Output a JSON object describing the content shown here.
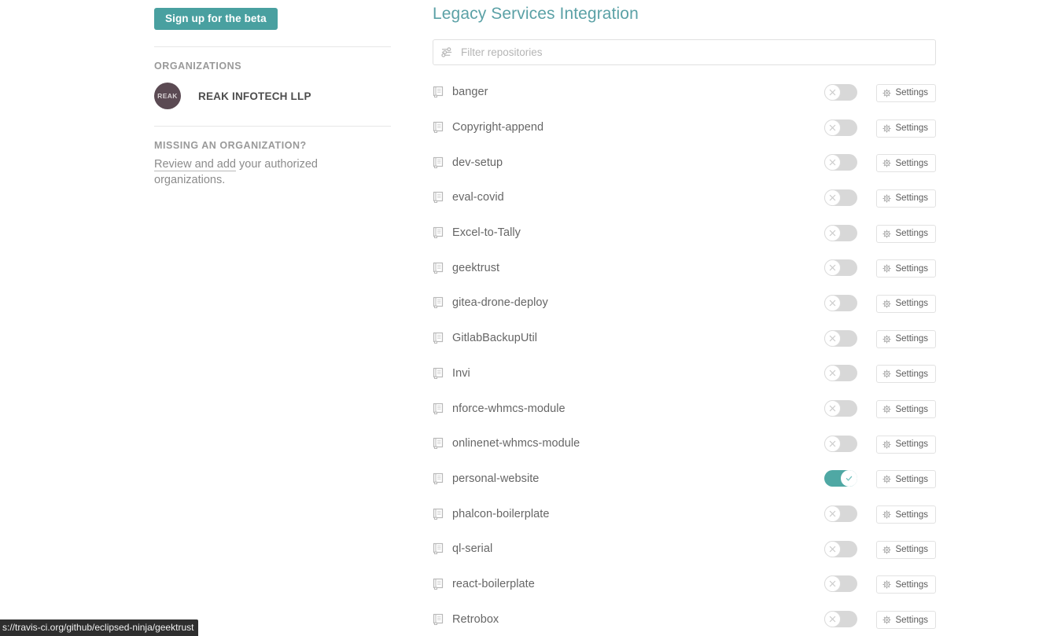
{
  "sidebar": {
    "beta_button_label": "Sign up for the beta",
    "organizations_label": "ORGANIZATIONS",
    "organization": {
      "avatar_text": "REAK",
      "name": "REAK INFOTECH LLP"
    },
    "missing_org_label": "MISSING AN ORGANIZATION?",
    "missing_org_link": "Review and add",
    "missing_org_rest": " your authorized organizations."
  },
  "main": {
    "title": "Legacy Services Integration",
    "filter": {
      "placeholder": "Filter repositories",
      "value": "",
      "icon": "sliders-icon"
    },
    "settings_label": "Settings",
    "repositories": [
      {
        "name": "banger",
        "enabled": false
      },
      {
        "name": "Copyright-append",
        "enabled": false
      },
      {
        "name": "dev-setup",
        "enabled": false
      },
      {
        "name": "eval-covid",
        "enabled": false
      },
      {
        "name": "Excel-to-Tally",
        "enabled": false
      },
      {
        "name": "geektrust",
        "enabled": false
      },
      {
        "name": "gitea-drone-deploy",
        "enabled": false
      },
      {
        "name": "GitlabBackupUtil",
        "enabled": false
      },
      {
        "name": "Invi",
        "enabled": false
      },
      {
        "name": "nforce-whmcs-module",
        "enabled": false
      },
      {
        "name": "onlinenet-whmcs-module",
        "enabled": false
      },
      {
        "name": "personal-website",
        "enabled": true
      },
      {
        "name": "phalcon-boilerplate",
        "enabled": false
      },
      {
        "name": "ql-serial",
        "enabled": false
      },
      {
        "name": "react-boilerplate",
        "enabled": false
      },
      {
        "name": "Retrobox",
        "enabled": false
      }
    ]
  },
  "status_bar": {
    "url": "s://travis-ci.org/github/eclipsed-ninja/geektrust"
  },
  "colors": {
    "accent_teal": "#49a0a0",
    "title_teal": "#5ba1a6",
    "toggle_on": "#4fa8a4",
    "toggle_off": "#d8d8d8",
    "avatar_bg": "#5b4a53",
    "status_bar_bg": "#2e2e2e"
  }
}
